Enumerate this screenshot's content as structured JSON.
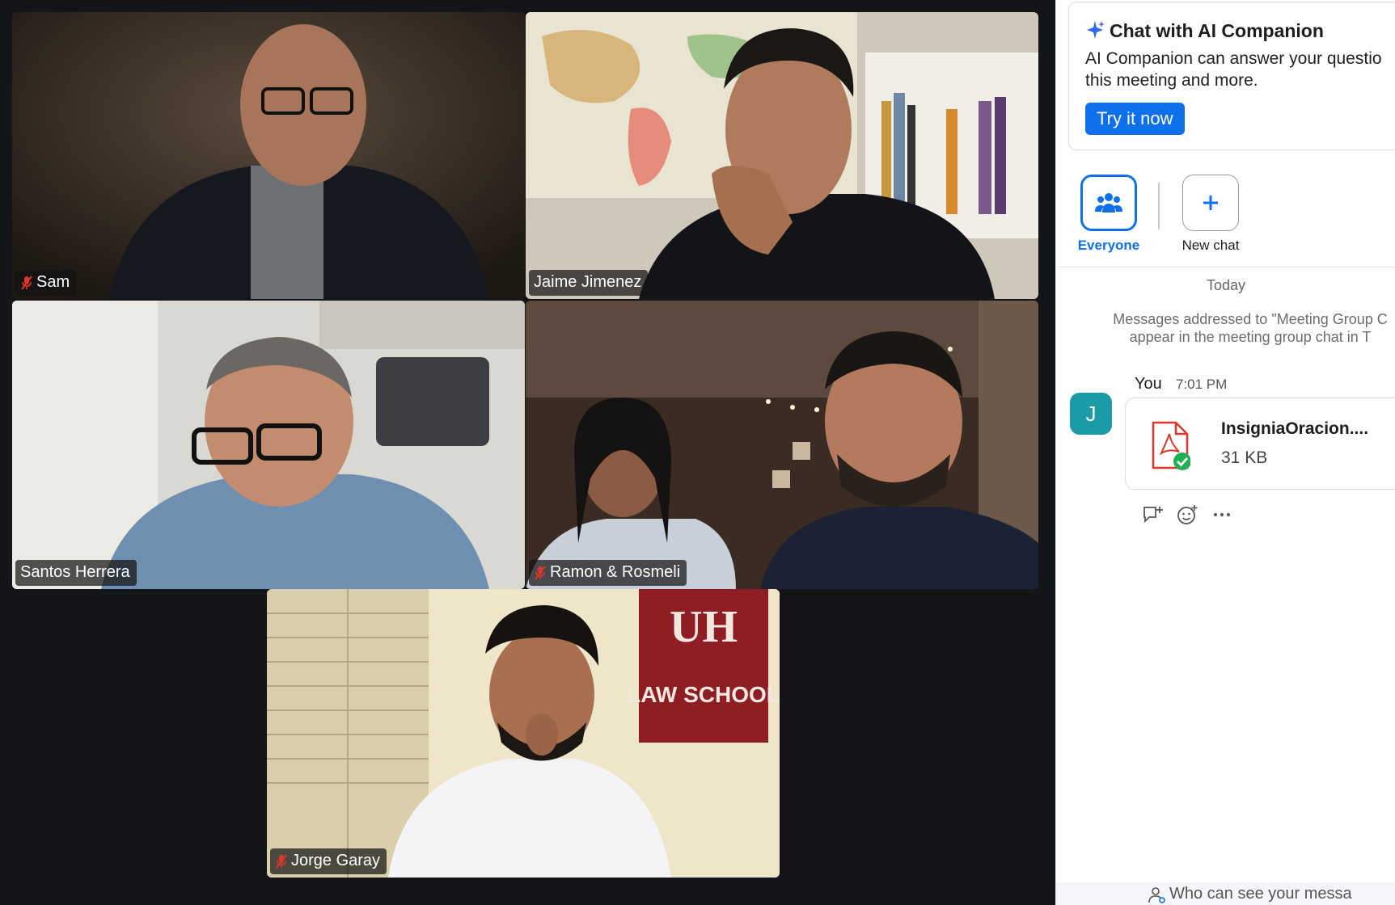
{
  "participants": [
    {
      "name": "Sam",
      "muted": true
    },
    {
      "name": "Jaime Jimenez",
      "muted": false
    },
    {
      "name": "Santos Herrera",
      "muted": false,
      "active_speaker": true
    },
    {
      "name": "Ramon & Rosmeli",
      "muted": true
    },
    {
      "name": "Jorge Garay",
      "muted": true
    }
  ],
  "background_text": {
    "banner_logo": "UH",
    "banner_text": "LAW SCHOOL"
  },
  "chat": {
    "ai_card": {
      "title": "Chat with AI Companion",
      "description": "AI Companion can answer your questio\nthis meeting and more.",
      "button_label": "Try it now"
    },
    "channels": [
      {
        "label": "Everyone",
        "icon": "people-icon",
        "selected": true
      },
      {
        "label": "New chat",
        "icon": "plus-icon",
        "selected": false
      }
    ],
    "date_divider": "Today",
    "system_message": "Messages addressed to \"Meeting Group C\nappear in the meeting group chat in T",
    "message": {
      "avatar_initial": "J",
      "sender": "You",
      "time": "7:01 PM",
      "file_name": "InsigniaOracion....",
      "file_size": "31 KB"
    },
    "footer_text": "Who can see your messa"
  },
  "colors": {
    "accent": "#0e71eb",
    "active_speaker": "#3fc94f",
    "avatar": "#1a9ba6",
    "muted_mic": "#e0352b"
  }
}
